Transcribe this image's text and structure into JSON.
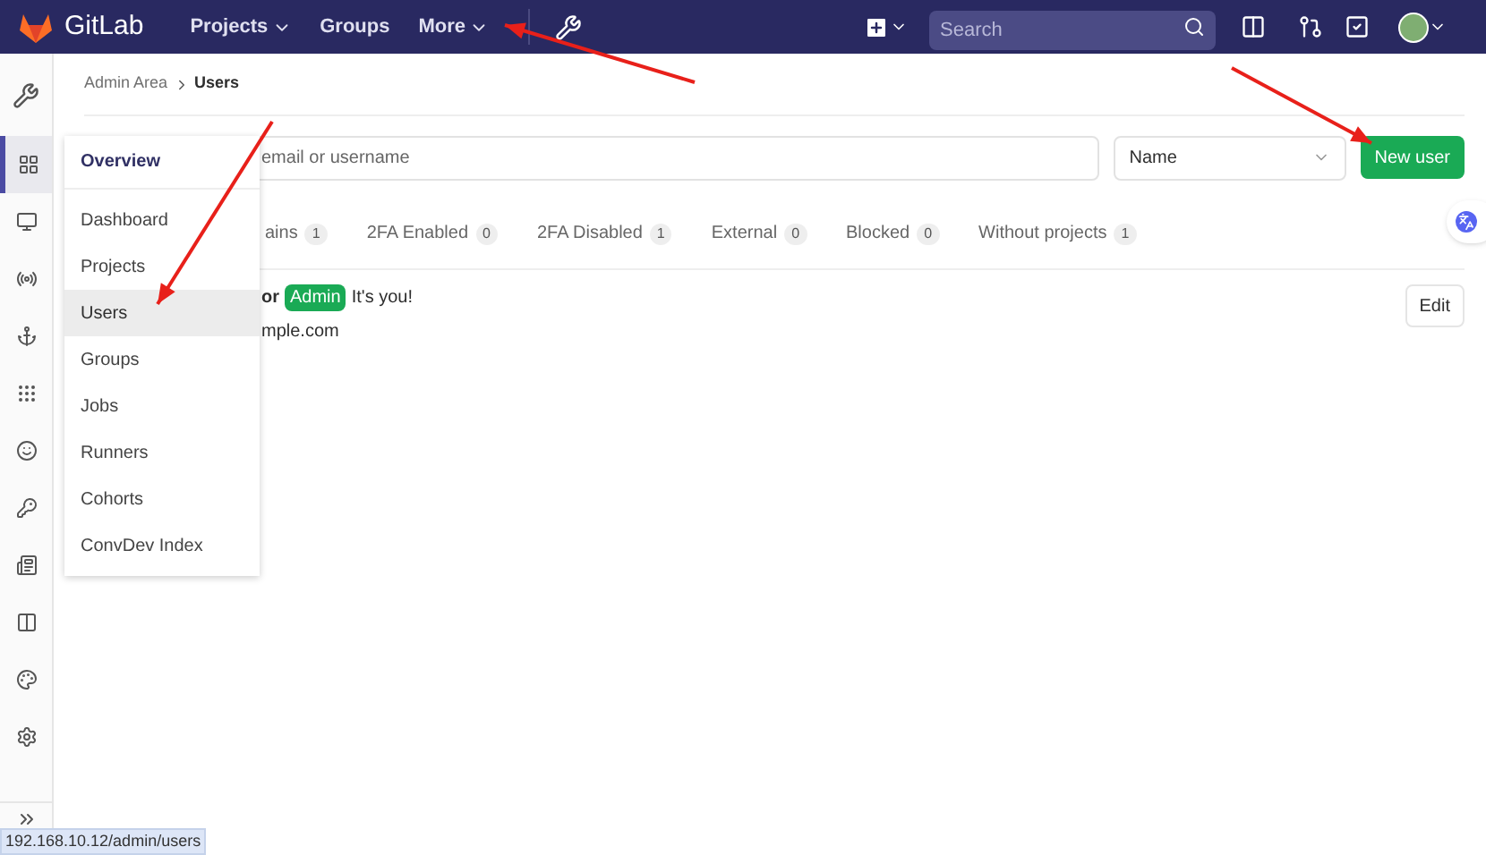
{
  "top_nav": {
    "brand": "GitLab",
    "links": [
      {
        "label": "Projects",
        "dropdown": true
      },
      {
        "label": "Groups",
        "dropdown": false
      },
      {
        "label": "More",
        "dropdown": true
      }
    ],
    "search": {
      "placeholder": "Search"
    }
  },
  "sidebar": {
    "items": [
      {
        "selected": true
      },
      {
        "selected": false
      },
      {
        "selected": false
      },
      {
        "selected": false
      },
      {
        "selected": false
      },
      {
        "selected": false
      },
      {
        "selected": false
      },
      {
        "selected": false
      },
      {
        "selected": false
      },
      {
        "selected": false
      },
      {
        "selected": false
      }
    ]
  },
  "flyout_menu": {
    "title": "Overview",
    "items": [
      {
        "label": "Dashboard",
        "selected": false
      },
      {
        "label": "Projects",
        "selected": false
      },
      {
        "label": "Users",
        "selected": true
      },
      {
        "label": "Groups",
        "selected": false
      },
      {
        "label": "Jobs",
        "selected": false
      },
      {
        "label": "Runners",
        "selected": false
      },
      {
        "label": "Cohorts",
        "selected": false
      },
      {
        "label": "ConvDev Index",
        "selected": false
      }
    ]
  },
  "breadcrumb": [
    "Admin Area",
    "Users"
  ],
  "filter": {
    "search_placeholder": "email or username",
    "sort": "Name",
    "new_button": "New user"
  },
  "tabs": [
    {
      "label": "ains",
      "count": "1"
    },
    {
      "label": "2FA Enabled",
      "count": "0"
    },
    {
      "label": "2FA Disabled",
      "count": "1"
    },
    {
      "label": "External",
      "count": "0"
    },
    {
      "label": "Blocked",
      "count": "0"
    },
    {
      "label": "Without projects",
      "count": "1"
    }
  ],
  "user_row": {
    "name": "or",
    "badge": "Admin",
    "note": "It's you!",
    "email": "mple.com",
    "action": "Edit"
  },
  "status_bar": "192.168.10.12/admin/users"
}
